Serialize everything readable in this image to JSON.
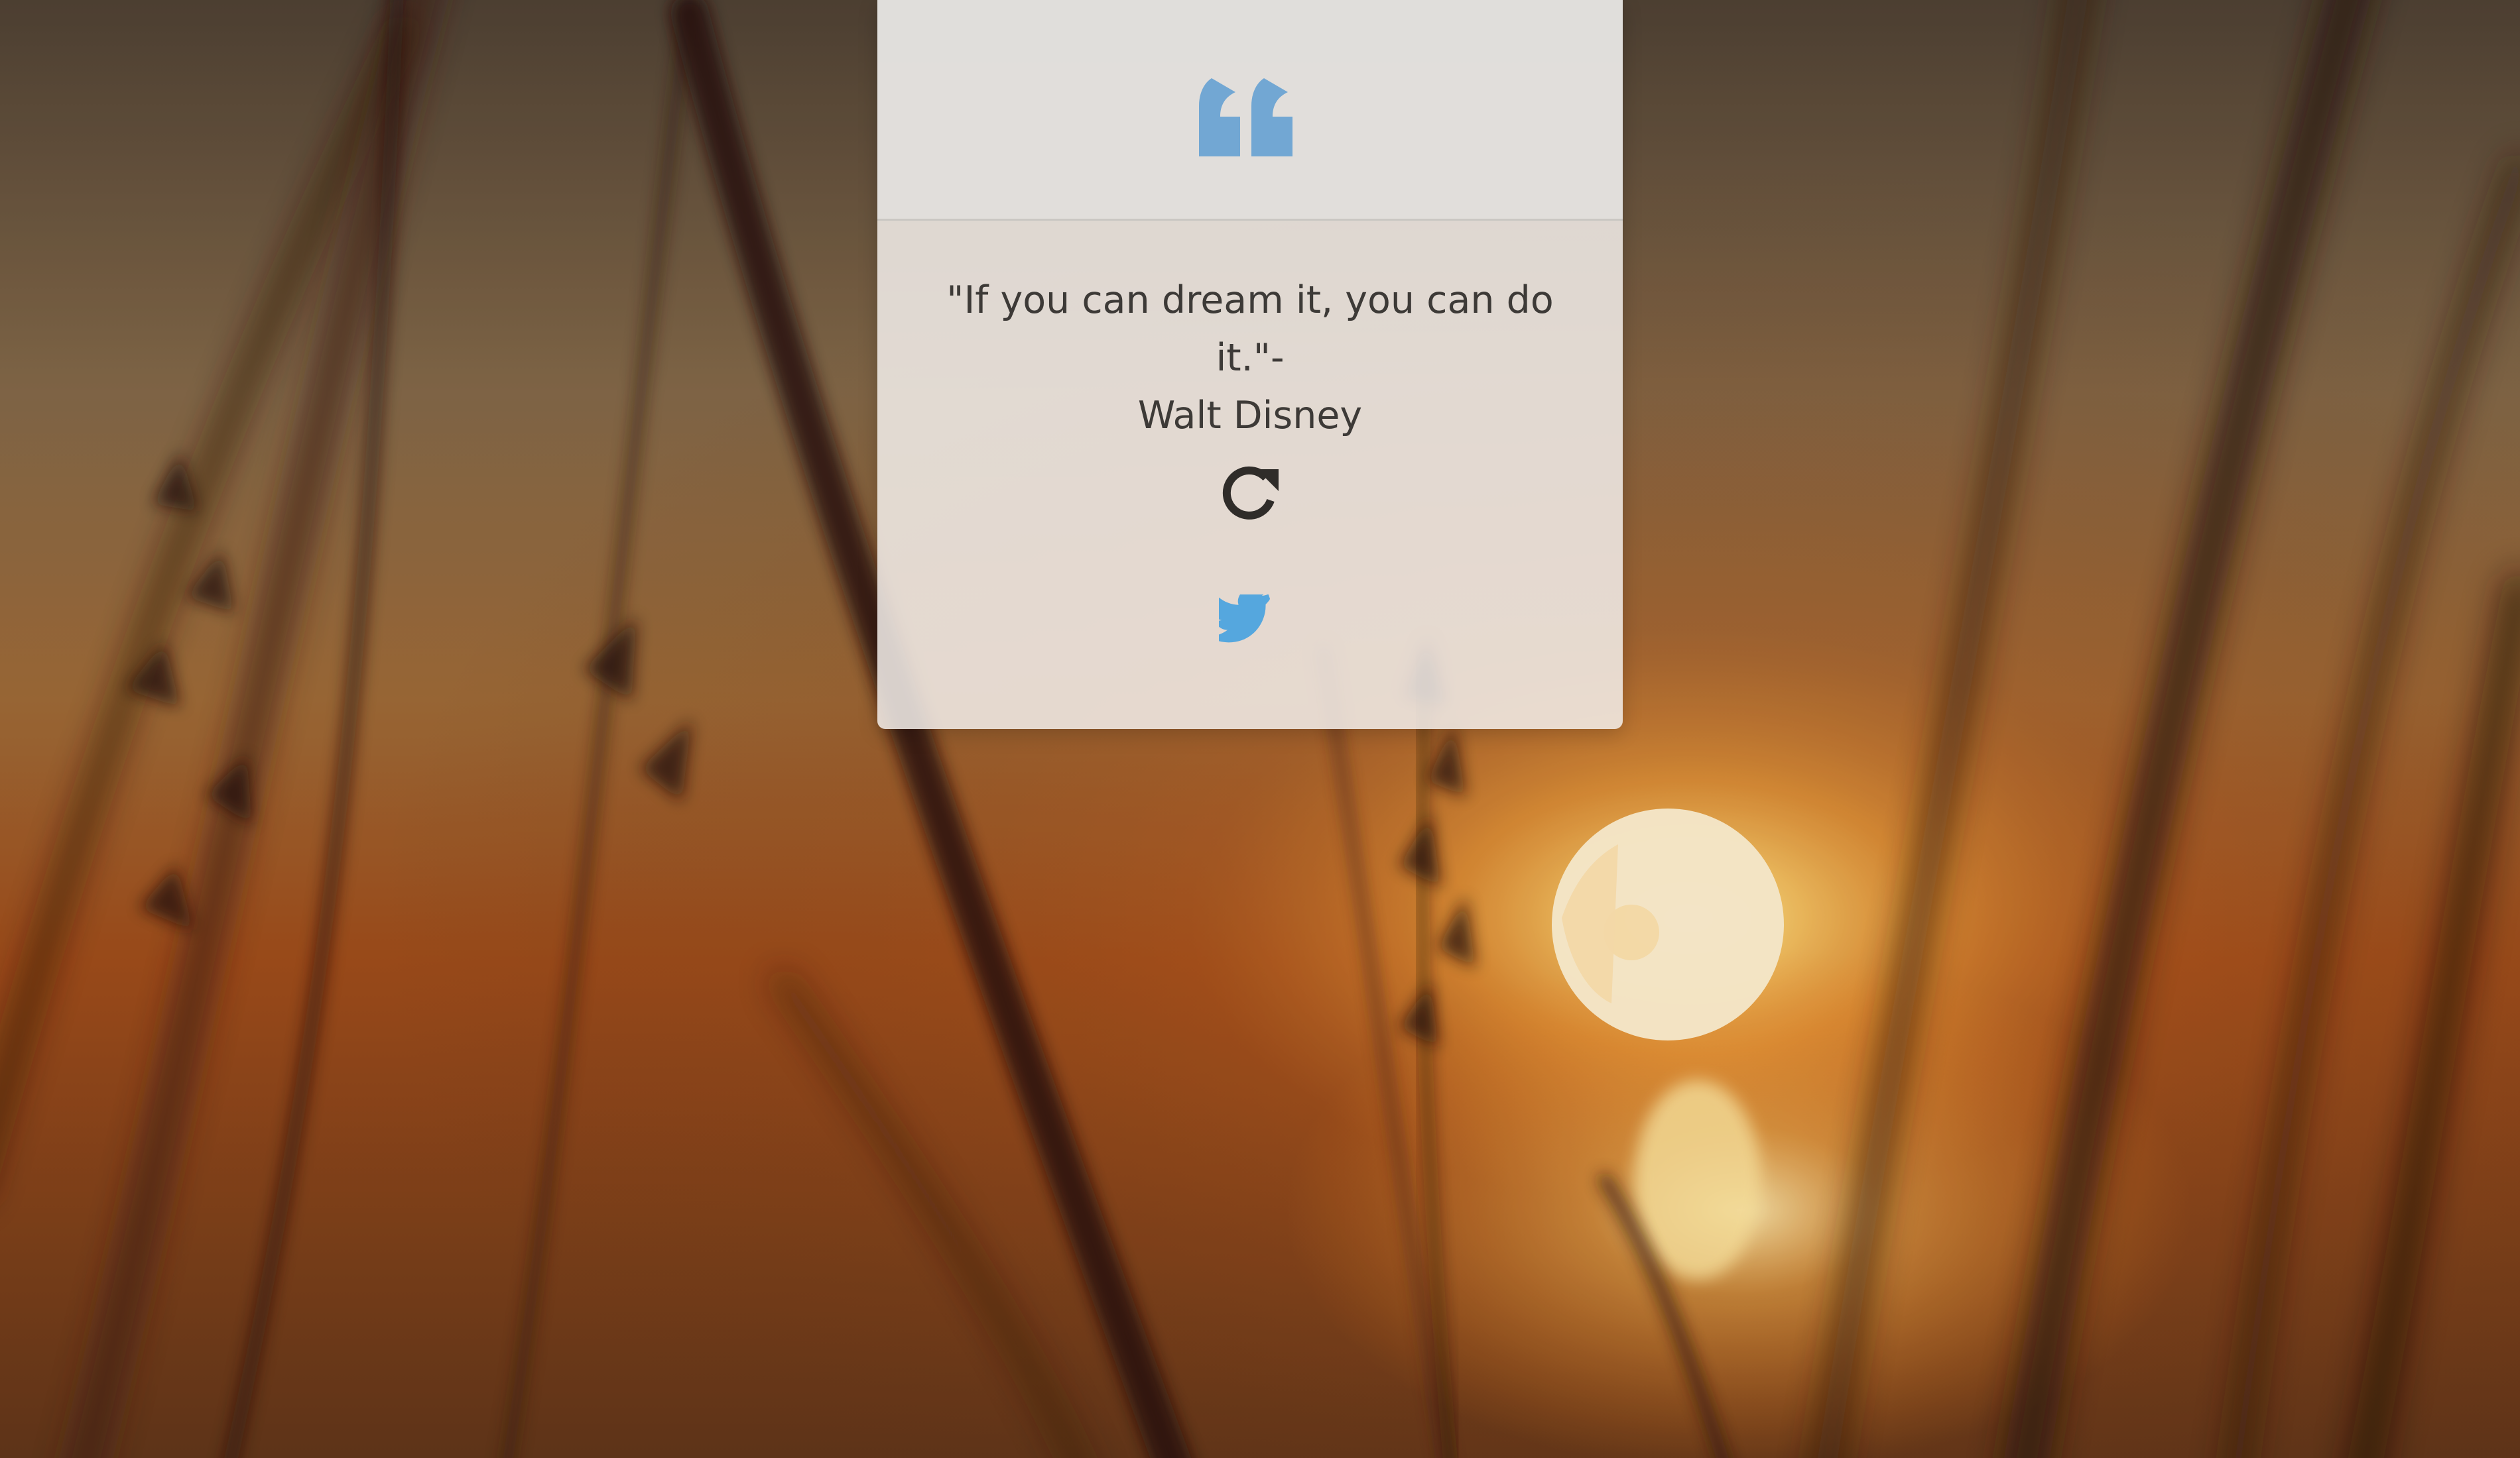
{
  "quote": {
    "text_line_1": "\"If you can dream it, you can do it.\"-",
    "text_line_2": "Walt Disney"
  },
  "icons": {
    "quote": "quote-icon",
    "refresh": "refresh-icon",
    "twitter": "twitter-icon"
  },
  "colors": {
    "quote_icon": "#72a7d3",
    "twitter_icon": "#55a7de",
    "text": "#3d3a37",
    "card": "#f2eeea"
  }
}
